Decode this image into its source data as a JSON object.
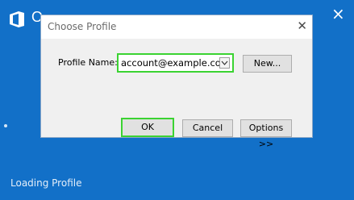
{
  "background": {
    "app_name_partial": "O",
    "loading_text": "Loading Profile"
  },
  "dialog": {
    "title": "Choose Profile",
    "profile_label": "Profile Name:",
    "profile_value": "account@example.com",
    "new_button": "New...",
    "ok_button": "OK",
    "cancel_button": "Cancel",
    "options_button": "Options >>"
  },
  "colors": {
    "background": "#1270c8",
    "highlight": "#3bd332"
  },
  "icons": {
    "office": "office-logo-icon",
    "close": "close-icon",
    "dropdown": "chevron-down-icon"
  }
}
